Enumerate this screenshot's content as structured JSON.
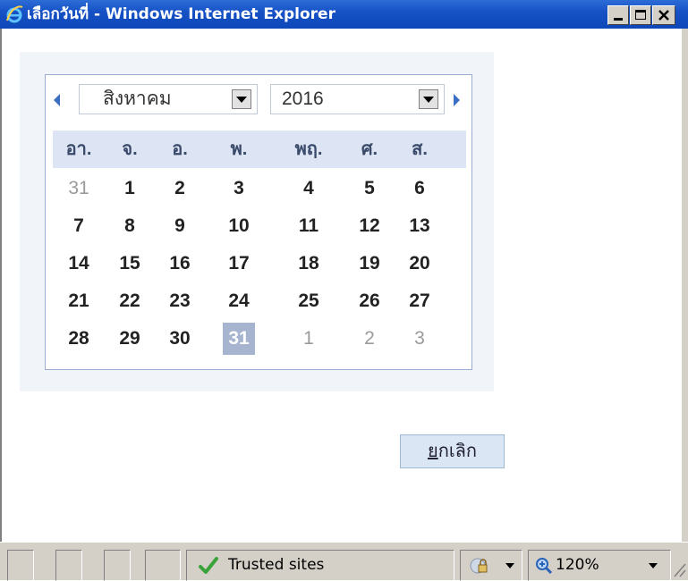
{
  "window": {
    "title": "เลือกวันที่ - Windows Internet Explorer"
  },
  "calendar": {
    "month": "สิงหาคม",
    "year": "2016",
    "weekdays": [
      "อา.",
      "จ.",
      "อ.",
      "พ.",
      "พฤ.",
      "ศ.",
      "ส."
    ],
    "weeks": [
      [
        "31",
        "1",
        "2",
        "3",
        "4",
        "5",
        "6"
      ],
      [
        "7",
        "8",
        "9",
        "10",
        "11",
        "12",
        "13"
      ],
      [
        "14",
        "15",
        "16",
        "17",
        "18",
        "19",
        "20"
      ],
      [
        "21",
        "22",
        "23",
        "24",
        "25",
        "26",
        "27"
      ],
      [
        "28",
        "29",
        "30",
        "31",
        "1",
        "2",
        "3"
      ]
    ],
    "selected_day": "31"
  },
  "actions": {
    "cancel_label": "ยกเลิก"
  },
  "statusbar": {
    "zone": "Trusted sites",
    "zoom": "120%"
  },
  "colors": {
    "titlebar": "#1752c6",
    "selected": "#a6b4d0",
    "weekday_row": "#dde4f3"
  }
}
